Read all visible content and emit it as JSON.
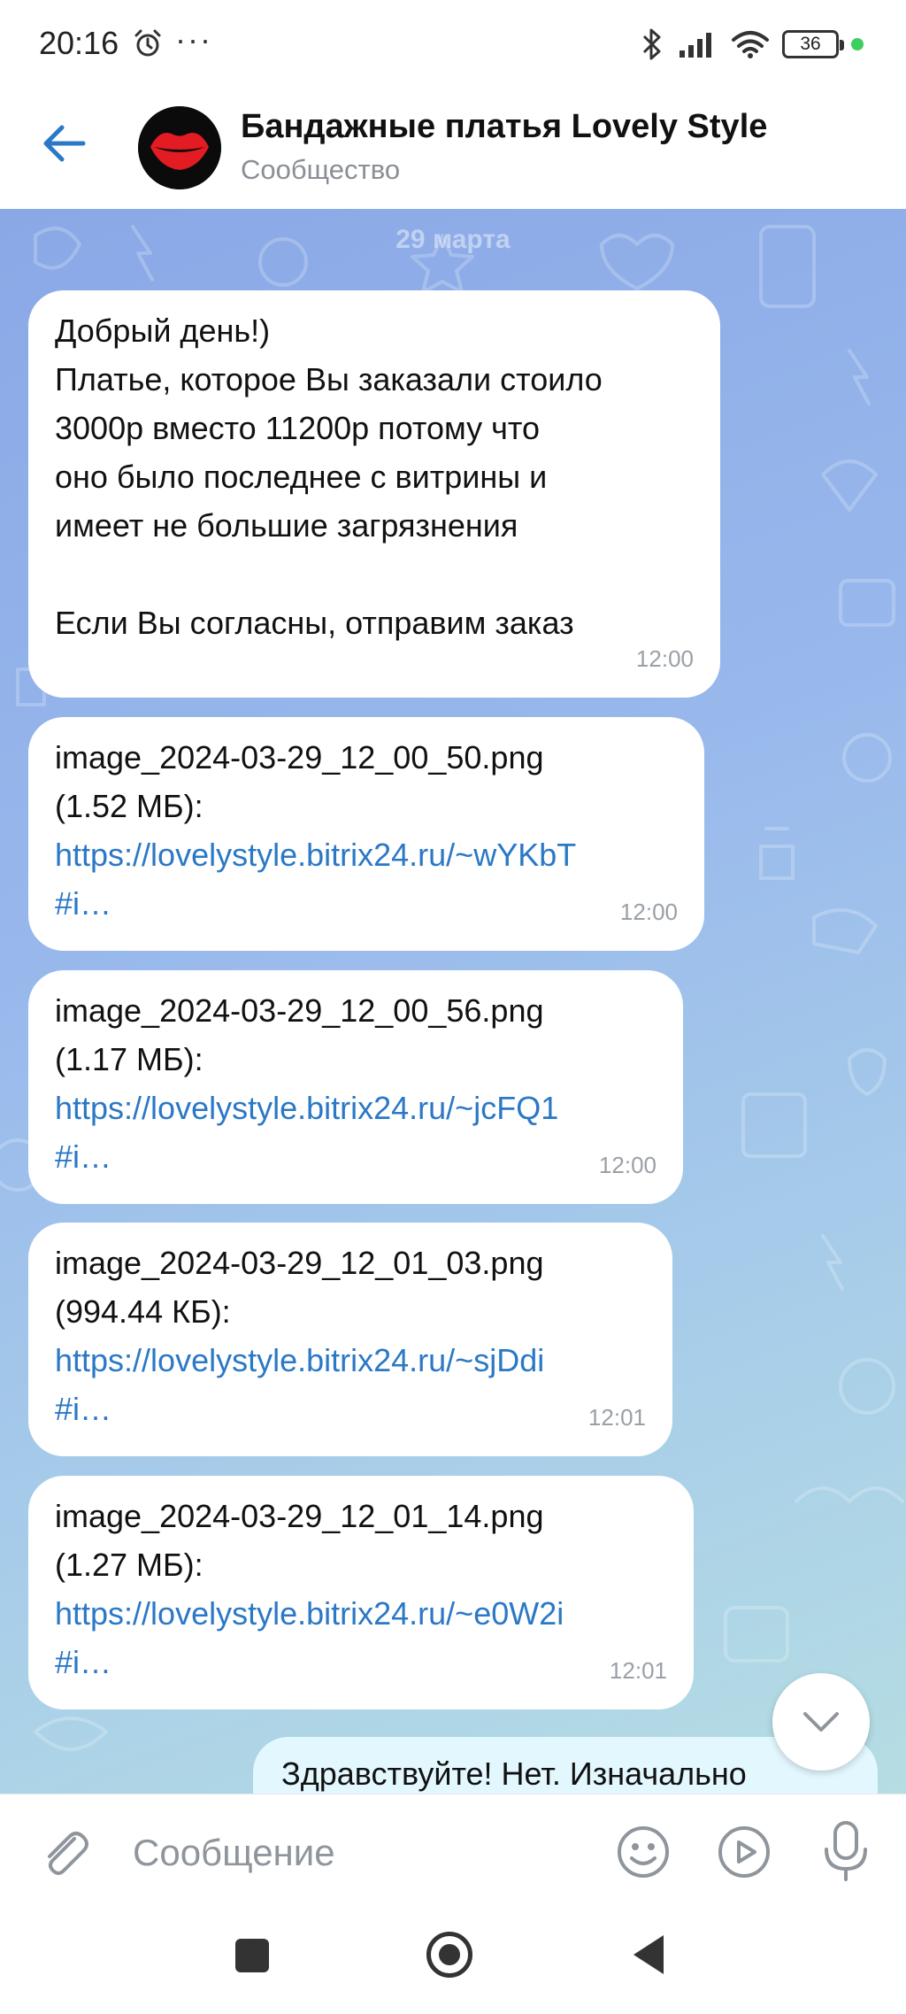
{
  "status_bar": {
    "time": "20:16",
    "more": "···",
    "battery": "36",
    "icons": [
      "alarm-icon",
      "bluetooth-icon",
      "signal-icon",
      "wifi-icon",
      "battery-icon",
      "active-dot"
    ]
  },
  "header": {
    "title": "Бандажные платья Lovely Style",
    "subtitle": "Сообщество",
    "back_icon": "back-arrow-icon",
    "avatar_icon": "lips-logo"
  },
  "chat": {
    "date_separator": "29 марта",
    "messages": [
      {
        "lines": [
          "Добрый день!)",
          "Платье, которое Вы заказали стоило",
          "3000р вместо 11200р потому что",
          "оно было последнее с витрины и",
          "имеет не большие загрязнения",
          "",
          "Если Вы согласны, отправим заказ"
        ],
        "time": "12:00"
      },
      {
        "file": "image_2024-03-29_12_00_50.png",
        "size": "(1.52 МБ):",
        "link": "https://lovelystyle.bitrix24.ru/~wYKbT",
        "link_tail": "#i…",
        "time": "12:00"
      },
      {
        "file": "image_2024-03-29_12_00_56.png",
        "size": "(1.17 МБ):",
        "link": "https://lovelystyle.bitrix24.ru/~jcFQ1",
        "link_tail": "#i…",
        "time": "12:00"
      },
      {
        "file": "image_2024-03-29_12_01_03.png",
        "size": "(994.44 КБ):",
        "link": "https://lovelystyle.bitrix24.ru/~sjDdi",
        "link_tail": "#i…",
        "time": "12:01"
      },
      {
        "file": "image_2024-03-29_12_01_14.png",
        "size": "(1.27 МБ):",
        "link": "https://lovelystyle.bitrix24.ru/~e0W2i",
        "link_tail": "#i…",
        "time": "12:01"
      }
    ],
    "outgoing_partial": "Здравствуйте! Нет. Изначально"
  },
  "composer": {
    "placeholder": "Сообщение",
    "icons": [
      "paperclip-icon",
      "emoji-icon",
      "video-message-icon",
      "microphone-icon"
    ]
  },
  "colors": {
    "accent": "#2b78c6",
    "link": "#2b78c6",
    "outgoing_bubble": "#e3f7ff",
    "wallpaper_top": "#8aa8e6",
    "wallpaper_bottom": "#b5dde2"
  }
}
